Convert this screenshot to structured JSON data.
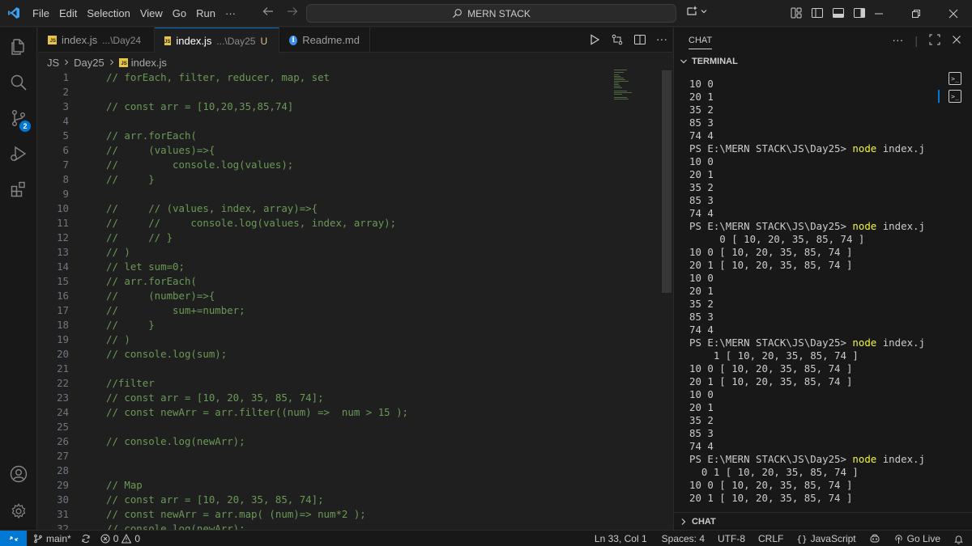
{
  "titlebar": {
    "menu": [
      "File",
      "Edit",
      "Selection",
      "View",
      "Go",
      "Run",
      "···"
    ],
    "search": "MERN STACK"
  },
  "tabs": [
    {
      "name": "index.js",
      "desc": "...\\Day24",
      "mod": "",
      "icon": "js-icon",
      "active": false
    },
    {
      "name": "index.js",
      "desc": "...\\Day25",
      "mod": "U",
      "icon": "js-icon",
      "active": true
    },
    {
      "name": "Readme.md",
      "desc": "",
      "mod": "",
      "icon": "info-icon",
      "active": false
    }
  ],
  "breadcrumb": [
    "JS",
    "Day25",
    "index.js"
  ],
  "activity": {
    "source_control_badge": "2"
  },
  "code_lines": [
    {
      "n": "1",
      "t": "// forEach, filter, reducer, map, set"
    },
    {
      "n": "2",
      "t": ""
    },
    {
      "n": "3",
      "t": "// const arr = [10,20,35,85,74]"
    },
    {
      "n": "4",
      "t": ""
    },
    {
      "n": "5",
      "t": "// arr.forEach("
    },
    {
      "n": "6",
      "t": "//     (values)=>{"
    },
    {
      "n": "7",
      "t": "//         console.log(values);"
    },
    {
      "n": "8",
      "t": "//     }"
    },
    {
      "n": "9",
      "t": ""
    },
    {
      "n": "10",
      "t": "//     // (values, index, array)=>{"
    },
    {
      "n": "11",
      "t": "//     //     console.log(values, index, array);"
    },
    {
      "n": "12",
      "t": "//     // }"
    },
    {
      "n": "13",
      "t": "// )"
    },
    {
      "n": "14",
      "t": "// let sum=0;"
    },
    {
      "n": "15",
      "t": "// arr.forEach("
    },
    {
      "n": "16",
      "t": "//     (number)=>{"
    },
    {
      "n": "17",
      "t": "//         sum+=number;"
    },
    {
      "n": "18",
      "t": "//     }"
    },
    {
      "n": "19",
      "t": "// )"
    },
    {
      "n": "20",
      "t": "// console.log(sum);"
    },
    {
      "n": "21",
      "t": ""
    },
    {
      "n": "22",
      "t": "//filter"
    },
    {
      "n": "23",
      "t": "// const arr = [10, 20, 35, 85, 74];"
    },
    {
      "n": "24",
      "t": "// const newArr = arr.filter((num) =>  num > 15 );"
    },
    {
      "n": "25",
      "t": ""
    },
    {
      "n": "26",
      "t": "// console.log(newArr);"
    },
    {
      "n": "27",
      "t": ""
    },
    {
      "n": "28",
      "t": ""
    },
    {
      "n": "29",
      "t": "// Map"
    },
    {
      "n": "30",
      "t": "// const arr = [10, 20, 35, 85, 74];"
    },
    {
      "n": "31",
      "t": "// const newArr = arr.map( (num)=> num*2 );"
    },
    {
      "n": "32",
      "t": "// console.log(newArr);"
    }
  ],
  "panel": {
    "chat_title": "CHAT",
    "terminal_title": "TERMINAL",
    "chat_section": "CHAT"
  },
  "terminal_lines": [
    {
      "pre": "10 0",
      "cmd": "",
      "post": ""
    },
    {
      "pre": "20 1",
      "cmd": "",
      "post": ""
    },
    {
      "pre": "35 2",
      "cmd": "",
      "post": ""
    },
    {
      "pre": "85 3",
      "cmd": "",
      "post": ""
    },
    {
      "pre": "74 4",
      "cmd": "",
      "post": ""
    },
    {
      "pre": "PS E:\\MERN STACK\\JS\\Day25> ",
      "cmd": "node",
      "post": " index.js"
    },
    {
      "pre": "10 0",
      "cmd": "",
      "post": ""
    },
    {
      "pre": "20 1",
      "cmd": "",
      "post": ""
    },
    {
      "pre": "35 2",
      "cmd": "",
      "post": ""
    },
    {
      "pre": "85 3",
      "cmd": "",
      "post": ""
    },
    {
      "pre": "74 4",
      "cmd": "",
      "post": ""
    },
    {
      "pre": "PS E:\\MERN STACK\\JS\\Day25> ",
      "cmd": "node",
      "post": " index.js"
    },
    {
      "pre": "     0 [ 10, 20, 35, 85, 74 ]",
      "cmd": "",
      "post": ""
    },
    {
      "pre": "10 0 [ 10, 20, 35, 85, 74 ]",
      "cmd": "",
      "post": ""
    },
    {
      "pre": "20 1 [ 10, 20, 35, 85, 74 ]",
      "cmd": "",
      "post": ""
    },
    {
      "pre": "10 0",
      "cmd": "",
      "post": ""
    },
    {
      "pre": "20 1",
      "cmd": "",
      "post": ""
    },
    {
      "pre": "35 2",
      "cmd": "",
      "post": ""
    },
    {
      "pre": "85 3",
      "cmd": "",
      "post": ""
    },
    {
      "pre": "74 4",
      "cmd": "",
      "post": ""
    },
    {
      "pre": "PS E:\\MERN STACK\\JS\\Day25> ",
      "cmd": "node",
      "post": " index.js"
    },
    {
      "pre": "    1 [ 10, 20, 35, 85, 74 ]",
      "cmd": "",
      "post": ""
    },
    {
      "pre": "10 0 [ 10, 20, 35, 85, 74 ]",
      "cmd": "",
      "post": ""
    },
    {
      "pre": "20 1 [ 10, 20, 35, 85, 74 ]",
      "cmd": "",
      "post": ""
    },
    {
      "pre": "10 0",
      "cmd": "",
      "post": ""
    },
    {
      "pre": "20 1",
      "cmd": "",
      "post": ""
    },
    {
      "pre": "35 2",
      "cmd": "",
      "post": ""
    },
    {
      "pre": "85 3",
      "cmd": "",
      "post": ""
    },
    {
      "pre": "74 4",
      "cmd": "",
      "post": ""
    },
    {
      "pre": "PS E:\\MERN STACK\\JS\\Day25> ",
      "cmd": "node",
      "post": " index.js"
    },
    {
      "pre": "  0 1 [ 10, 20, 35, 85, 74 ]",
      "cmd": "",
      "post": ""
    },
    {
      "pre": "10 0 [ 10, 20, 35, 85, 74 ]",
      "cmd": "",
      "post": ""
    },
    {
      "pre": "20 1 [ 10, 20, 35, 85, 74 ]",
      "cmd": "",
      "post": ""
    }
  ],
  "statusbar": {
    "branch": "main*",
    "errors": "0",
    "warnings": "0",
    "position": "Ln 33, Col 1",
    "spaces": "Spaces: 4",
    "encoding": "UTF-8",
    "eol": "CRLF",
    "language": "JavaScript",
    "golive": "Go Live"
  },
  "colors": {
    "accent": "#0078d4",
    "comment": "#6a9955",
    "terminal_command": "#f5f543",
    "modified": "#e2c08d"
  }
}
